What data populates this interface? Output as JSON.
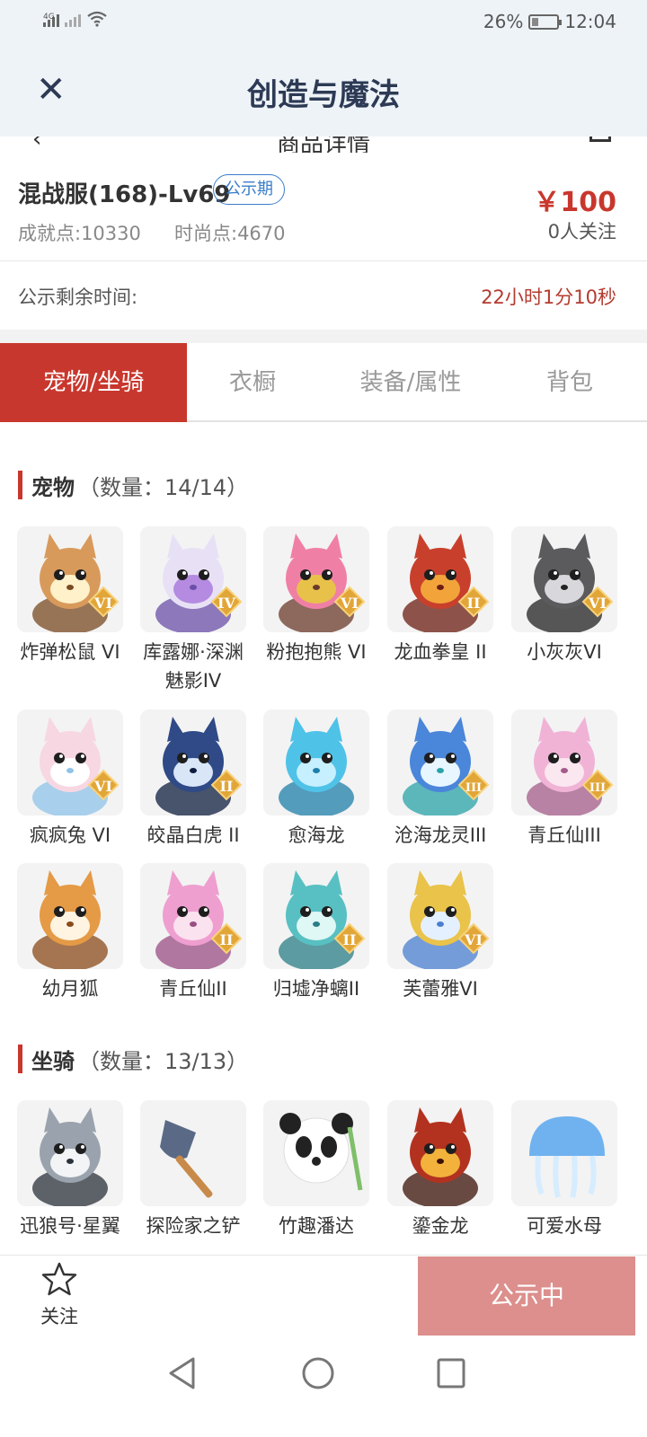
{
  "status_bar": {
    "network1": "4G",
    "battery": "26%",
    "battery_level": 0.26,
    "time": "12:04"
  },
  "app_bar": {
    "title": "创造与魔法"
  },
  "subheader": {
    "title": "商品详情"
  },
  "item": {
    "name": "混战服(168)-Lv69",
    "badge": "公示期",
    "price": "￥100",
    "achievement": "成就点:10330",
    "fashion": "时尚点:4670",
    "followers": "0人关注"
  },
  "remaining": {
    "label": "公示剩余时间:",
    "value": "22小时1分10秒"
  },
  "tabs": [
    {
      "label": "宠物/坐骑",
      "active": true
    },
    {
      "label": "衣橱",
      "active": false
    },
    {
      "label": "装备/属性",
      "active": false
    },
    {
      "label": "背包",
      "active": false
    }
  ],
  "pets": {
    "title": "宠物",
    "count": "（数量：14/14）",
    "items": [
      {
        "name": "炸弹松鼠 VI",
        "icon": "squirrel-icon",
        "tier": "VI"
      },
      {
        "name": "库露娜·深渊魅影IV",
        "icon": "kuluna-icon",
        "tier": "IV"
      },
      {
        "name": "粉抱抱熊 VI",
        "icon": "pink-bear-icon",
        "tier": "VI"
      },
      {
        "name": "龙血拳皇 II",
        "icon": "dragon-blood-icon",
        "tier": "II"
      },
      {
        "name": "小灰灰VI",
        "icon": "grey-wolf-icon",
        "tier": "VI"
      },
      {
        "name": "疯疯兔 VI",
        "icon": "crazy-rabbit-icon",
        "tier": "VI"
      },
      {
        "name": "皎晶白虎 II",
        "icon": "white-tiger-icon",
        "tier": "II"
      },
      {
        "name": "愈海龙",
        "icon": "sea-dragon-icon",
        "tier": ""
      },
      {
        "name": "沧海龙灵III",
        "icon": "dragon-spirit-icon",
        "tier": "III"
      },
      {
        "name": "青丘仙III",
        "icon": "fox-fairy-icon",
        "tier": "III"
      },
      {
        "name": "幼月狐",
        "icon": "moon-fox-icon",
        "tier": ""
      },
      {
        "name": "青丘仙II",
        "icon": "fox-fairy-2-icon",
        "tier": "II"
      },
      {
        "name": "归墟净螭II",
        "icon": "water-dragon-icon",
        "tier": "II"
      },
      {
        "name": "芙蕾雅VI",
        "icon": "freya-icon",
        "tier": "VI"
      }
    ]
  },
  "mounts": {
    "title": "坐骑",
    "count": "（数量：13/13）",
    "items": [
      {
        "name": "迅狼号·星翼",
        "icon": "mech-wolf-icon"
      },
      {
        "name": "探险家之铲",
        "icon": "shovel-icon"
      },
      {
        "name": "竹趣潘达",
        "icon": "panda-icon"
      },
      {
        "name": "鎏金龙",
        "icon": "golden-dragon-icon"
      },
      {
        "name": "可爱水母",
        "icon": "jellyfish-icon"
      }
    ]
  },
  "bottom": {
    "follow_label": "关注",
    "cta_label": "公示中"
  },
  "colors": {
    "accent": "#c8372d",
    "badge_blue": "#3a7dc9",
    "cta": "#dc8f8c",
    "appbar": "#eef3f8"
  }
}
